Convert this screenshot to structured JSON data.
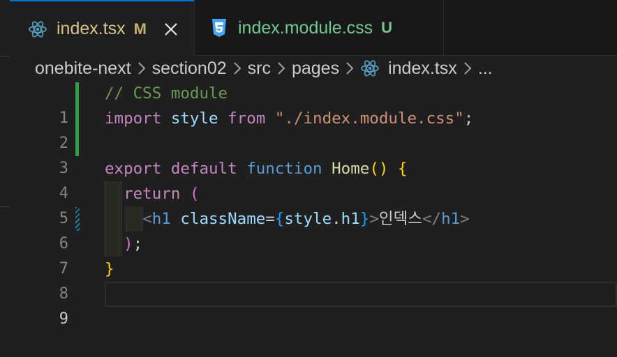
{
  "tabs": [
    {
      "icon": "react-icon",
      "label": "index.tsx",
      "badge": "M",
      "active": true
    },
    {
      "icon": "css-icon",
      "label": "index.module.css",
      "badge": "U",
      "active": false
    }
  ],
  "breadcrumb": [
    "onebite-next",
    "section02",
    "src",
    "pages",
    "index.tsx",
    "..."
  ],
  "editor": {
    "line_numbers": [
      "1",
      "2",
      "3",
      "4",
      "5",
      "6",
      "7",
      "8",
      "9"
    ],
    "current_line": 9,
    "lines": [
      {
        "comment": "// CSS module"
      },
      {
        "kw": "import",
        "var": "style",
        "kw2": "from",
        "str": "\"./index.module.css\"",
        "end": ";"
      },
      {},
      {
        "kw": "export",
        "kw2": "default",
        "decl": "function",
        "fn": "Home",
        "parens": "()",
        "brace": "{"
      },
      {
        "kw": "return",
        "paren": "("
      },
      {
        "lt": "<",
        "tag": "h1",
        "attr": "className",
        "eq": "=",
        "open": "{",
        "var": "style",
        "dot": ".",
        "prop": "h1",
        "close": "}",
        "gt": ">",
        "text": "인덱스",
        "lt2": "</",
        "tag2": "h1",
        "gt2": ">"
      },
      {
        "paren": ")",
        "end": ";"
      },
      {
        "brace": "}"
      },
      {}
    ]
  },
  "colors": {
    "accent": "#0078d4",
    "modified": "#c8ae6f",
    "untracked": "#73c991",
    "git_added": "#2ea043"
  }
}
